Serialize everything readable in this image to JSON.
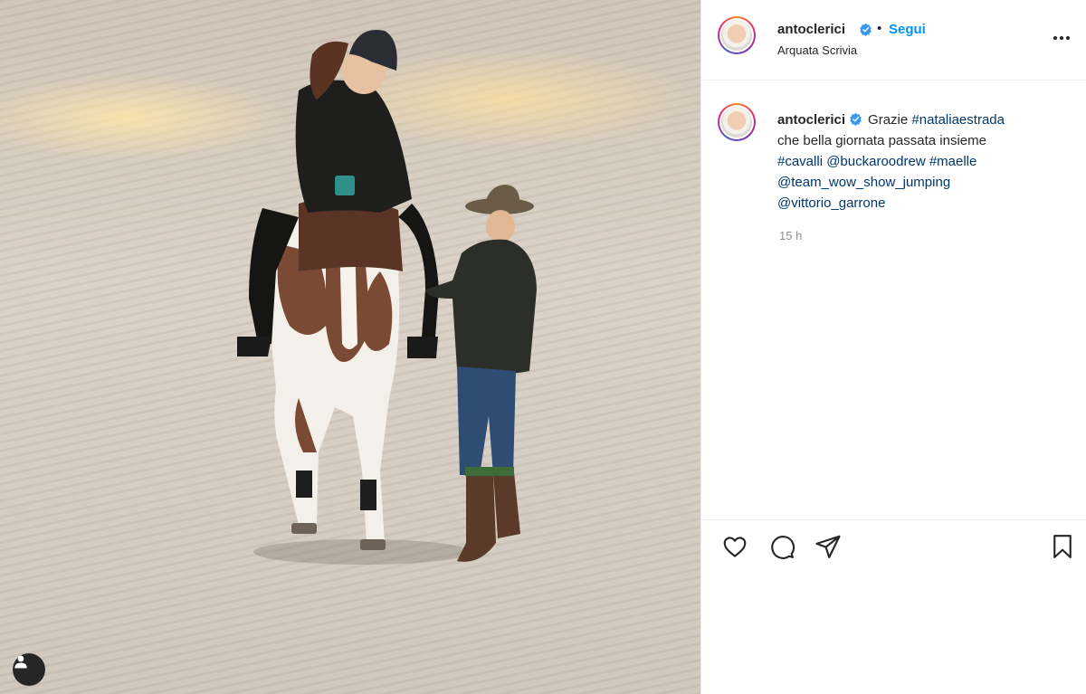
{
  "post": {
    "author": "antoclerici",
    "follow_label": "Segui",
    "separator": "•",
    "location": "Arquata Scrivia",
    "caption": {
      "author": "antoclerici",
      "text_start": "Grazie",
      "tag_nataliaestrada": "#nataliaestrada",
      "line2": "che bella giornata passata insieme",
      "tag_cavalli": "#cavalli",
      "mention_buckaroodrew": "@buckaroodrew",
      "tag_maelle": "#maelle",
      "mention_team": "@team_wow_show_jumping",
      "mention_vittorio": "@vittorio_garrone"
    },
    "time": "15 h"
  },
  "icons": {
    "verified": "verified-badge-icon",
    "more": "more-options-icon",
    "like": "heart-icon",
    "comment": "comment-icon",
    "share": "paper-plane-icon",
    "save": "bookmark-icon",
    "tagged_user": "user-tag-icon"
  },
  "colors": {
    "link_blue": "#0095f6",
    "tag_blue": "#00376b",
    "muted": "#8e8e8e",
    "text": "#262626"
  }
}
